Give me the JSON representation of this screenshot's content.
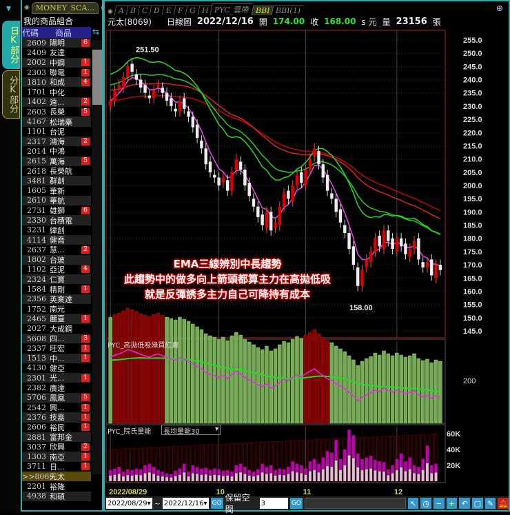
{
  "sidebar": {
    "tab_daily": "日K部分",
    "tab_minute": "分K部分"
  },
  "list": {
    "tab": "MONEY_SCA...",
    "title": "我的商品組合",
    "col_code": "代碼",
    "col_name": "商品",
    "rows": [
      [
        "2609",
        "陽明",
        "6"
      ],
      [
        "2409",
        "友達",
        ""
      ],
      [
        "2002",
        "中鋼",
        "1"
      ],
      [
        "2303",
        "聯電",
        "1"
      ],
      [
        "1810",
        "和成",
        "4"
      ],
      [
        "1701",
        "中化",
        ""
      ],
      [
        "1402",
        "遠...",
        "2"
      ],
      [
        "2603",
        "長榮",
        "5"
      ],
      [
        "4167",
        "松瑞藥",
        ""
      ],
      [
        "1101",
        "台泥",
        ""
      ],
      [
        "2317",
        "鴻海",
        "2"
      ],
      [
        "2014",
        "中鴻",
        ""
      ],
      [
        "2615",
        "萬海",
        "5"
      ],
      [
        "2618",
        "長榮航",
        ""
      ],
      [
        "3481",
        "群創",
        ""
      ],
      [
        "1605",
        "華新",
        ""
      ],
      [
        "2610",
        "華航",
        ""
      ],
      [
        "2731",
        "雄獅",
        "6"
      ],
      [
        "2330",
        "台積電",
        ""
      ],
      [
        "3231",
        "緯創",
        ""
      ],
      [
        "4114",
        "健喬",
        ""
      ],
      [
        "2637",
        "慧...",
        "2"
      ],
      [
        "1802",
        "台玻",
        ""
      ],
      [
        "1102",
        "亞泥",
        "4"
      ],
      [
        "2324",
        "仁寶",
        ""
      ],
      [
        "1584",
        "精剛",
        "1"
      ],
      [
        "2356",
        "英業達",
        ""
      ],
      [
        "1752",
        "南光",
        ""
      ],
      [
        "2465",
        "麗臺",
        "1"
      ],
      [
        "2027",
        "大成鋼",
        ""
      ],
      [
        "5608",
        "四...",
        "3"
      ],
      [
        "2337",
        "旺宏",
        "1"
      ],
      [
        "1513",
        "中...",
        "1"
      ],
      [
        "4130",
        "健亞",
        ""
      ],
      [
        "2301",
        "光...",
        "1"
      ],
      [
        "2382",
        "廣達",
        ""
      ],
      [
        "5706",
        "鳳凰",
        "5"
      ],
      [
        "2542",
        "興...",
        "1"
      ],
      [
        "2376",
        "技嘉",
        "1"
      ],
      [
        "2606",
        "裕民",
        "1"
      ],
      [
        "2881",
        "富邦金",
        ""
      ],
      [
        "3037",
        "欣興",
        "2"
      ],
      [
        "1303",
        "南亞",
        "1"
      ],
      [
        "3711",
        "日...",
        "1"
      ],
      [
        ">>8069",
        "元太",
        ""
      ],
      [
        "2201",
        "裕隆",
        ""
      ],
      [
        "4938",
        "和碩",
        ""
      ]
    ]
  },
  "tabs": [
    "A",
    "B",
    "C",
    "D",
    "E",
    "F",
    "G",
    "H",
    "PYC_雲帶",
    "BBI",
    "BBI(1)"
  ],
  "active_tab": "BBI",
  "info": {
    "name": "元太(8069)",
    "type": "日線圖",
    "date": "2022/12/16",
    "open_label": "開",
    "open": "174.00",
    "close_label": "收",
    "close": "168.00",
    "unit": "s 元",
    "vol_label": "量",
    "volume": "23156",
    "vol_unit": "張"
  },
  "annotation": {
    "line1": "EMA三線辨別中長趨勢",
    "line2": "此趨勢中的做多向上箭頭都算主力在高拋低吸",
    "line3": "就是反彈誘多主力自己可降持有成本"
  },
  "panel2": {
    "title": "PYC_高拋低吸綠買紅賣",
    "axis_label": "200"
  },
  "panel3": {
    "title": "PYC_院氏量能",
    "select": "長均量能30"
  },
  "bottom": {
    "from": "2022/08/29",
    "to": "2022/12/16",
    "go": "GO",
    "keep_label": "保留空間",
    "keep_value": "3"
  },
  "chart_data": {
    "type": "candlestick",
    "ylim": [
      145,
      255
    ],
    "yticks": [
      "255.0",
      "250.0",
      "245.0",
      "240.0",
      "235.0",
      "230.0",
      "225.0",
      "220.0",
      "215.0",
      "210.0",
      "205.0",
      "200.0",
      "195.0",
      "190.0",
      "185.0",
      "180.0",
      "175.0",
      "170.0",
      "165.0",
      "160.0",
      "155.0",
      "150.0",
      "145.0"
    ],
    "high_label": "251.50",
    "low_label": "158.00",
    "x_labels": [
      {
        "i": 0,
        "t": "2022/08/29"
      },
      {
        "i": 25,
        "t": "10"
      },
      {
        "i": 45,
        "t": "11"
      },
      {
        "i": 66,
        "t": "12"
      }
    ],
    "close": [
      232,
      236,
      238,
      241,
      245,
      243,
      240,
      237,
      235,
      233,
      236,
      238,
      235,
      232,
      230,
      228,
      232,
      229,
      226,
      222,
      218,
      214,
      208,
      205,
      203,
      200,
      203,
      198,
      205,
      210,
      206,
      200,
      196,
      192,
      188,
      185,
      190,
      183,
      186,
      192,
      197,
      195,
      200,
      204,
      201,
      206,
      210,
      214,
      208,
      203,
      198,
      195,
      190,
      186,
      182,
      176,
      170,
      162,
      168,
      172,
      175,
      180,
      177,
      183,
      179,
      176,
      180,
      177,
      174,
      176,
      179,
      172,
      169,
      171,
      166,
      170,
      168
    ],
    "volume_k": [
      14,
      16,
      18,
      12,
      15,
      14,
      16,
      15,
      20,
      22,
      18,
      14,
      12,
      10,
      9,
      13,
      16,
      22,
      12,
      20,
      18,
      16,
      17,
      14,
      16,
      15,
      13,
      14,
      12,
      20,
      22,
      18,
      14,
      12,
      15,
      22,
      18,
      20,
      14,
      16,
      15,
      18,
      25,
      22,
      20,
      16,
      25,
      28,
      22,
      30,
      38,
      36,
      52,
      28,
      40,
      65,
      58,
      35,
      28,
      30,
      32,
      27,
      25,
      24,
      15,
      20,
      28,
      35,
      25,
      30,
      20,
      18,
      28,
      45,
      20,
      22
    ],
    "volume_ticks": [
      "60K",
      "40K",
      "20K"
    ]
  }
}
